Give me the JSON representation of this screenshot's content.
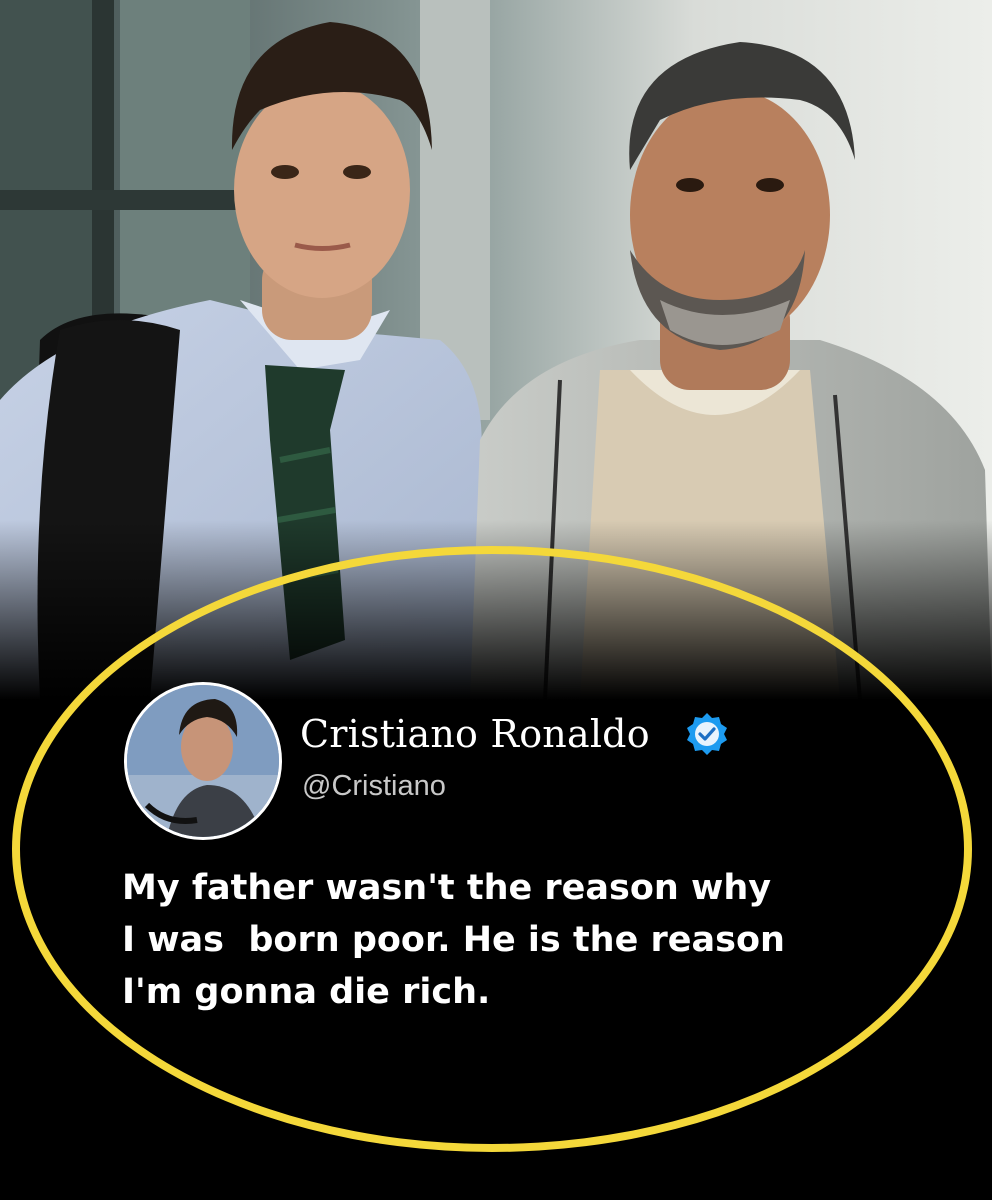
{
  "photo": {
    "people": [
      "young-man-with-tie",
      "older-bearded-man"
    ]
  },
  "highlight": {
    "color": "#f4d83a"
  },
  "tweet": {
    "display_name": "Cristiano Ronaldo",
    "handle": "@Cristiano",
    "verified": true,
    "verified_color": "#1d9bf0",
    "text_lines": [
      "My father wasn't the reason why",
      "I was  born poor. He is the reason",
      "I'm gonna die rich."
    ]
  }
}
